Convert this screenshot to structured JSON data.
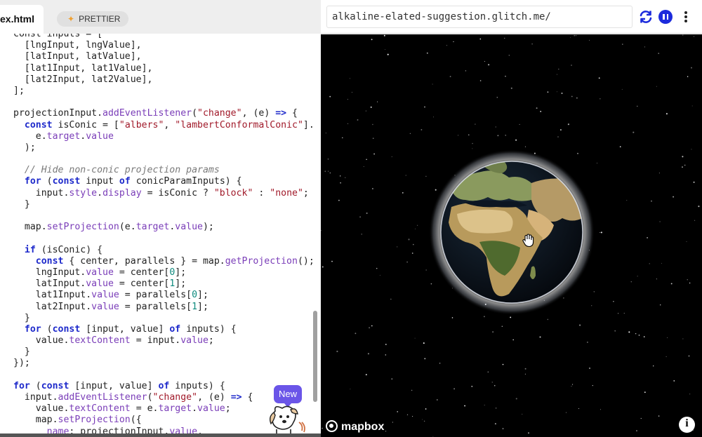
{
  "editor": {
    "file_tab": "ex.html",
    "prettier_label": "PRETTIER",
    "new_badge": "New"
  },
  "preview": {
    "url": "alkaline-elated-suggestion.glitch.me/",
    "mapbox_label": "mapbox",
    "info_label": "i"
  },
  "icons": {
    "refresh": "refresh-icon",
    "pause": "pause-icon",
    "menu": "kebab-menu-icon",
    "info": "info-icon",
    "cursor": "grab-hand-icon",
    "prettier": "sparkle-icon"
  },
  "colors": {
    "keyword": "#1e2acb",
    "string": "#a11a2a",
    "property": "#7a3db8",
    "number": "#0e8a7e",
    "comment": "#7a7a7a",
    "pause_button": "#1c2bdc",
    "new_badge": "#6a55e8"
  },
  "code": [
    [
      [
        "",
        "const inputs = ["
      ]
    ],
    [
      [
        "",
        "  [lngInput, lngValue],"
      ]
    ],
    [
      [
        "",
        "  [latInput, latValue],"
      ]
    ],
    [
      [
        "",
        "  [lat1Input, lat1Value],"
      ]
    ],
    [
      [
        "",
        "  [lat2Input, lat2Value],"
      ]
    ],
    [
      [
        "",
        "];"
      ]
    ],
    [
      [
        "",
        ""
      ]
    ],
    [
      [
        "",
        "projectionInput."
      ],
      [
        "p",
        "addEventListener"
      ],
      [
        "",
        "("
      ],
      [
        "s",
        "\"change\""
      ],
      [
        "",
        ", (e) "
      ],
      [
        "k",
        "=>"
      ],
      [
        "",
        " {"
      ]
    ],
    [
      [
        "",
        "  "
      ],
      [
        "k",
        "const"
      ],
      [
        "",
        " isConic = ["
      ],
      [
        "s",
        "\"albers\""
      ],
      [
        "",
        ", "
      ],
      [
        "s",
        "\"lambertConformalConic\""
      ],
      [
        "",
        "]."
      ]
    ],
    [
      [
        "",
        "    e."
      ],
      [
        "p",
        "target"
      ],
      [
        "",
        "."
      ],
      [
        "p",
        "value"
      ]
    ],
    [
      [
        "",
        "  );"
      ]
    ],
    [
      [
        "",
        ""
      ]
    ],
    [
      [
        "c",
        "  // Hide non-conic projection params"
      ]
    ],
    [
      [
        "",
        "  "
      ],
      [
        "k",
        "for"
      ],
      [
        "",
        " ("
      ],
      [
        "k",
        "const"
      ],
      [
        "",
        " input "
      ],
      [
        "k",
        "of"
      ],
      [
        "",
        " conicParamInputs) {"
      ]
    ],
    [
      [
        "",
        "    input."
      ],
      [
        "p",
        "style"
      ],
      [
        "",
        "."
      ],
      [
        "p",
        "display"
      ],
      [
        "",
        " = isConic ? "
      ],
      [
        "s",
        "\"block\""
      ],
      [
        "",
        " : "
      ],
      [
        "s",
        "\"none\""
      ],
      [
        "",
        ";"
      ]
    ],
    [
      [
        "",
        "  }"
      ]
    ],
    [
      [
        "",
        ""
      ]
    ],
    [
      [
        "",
        "  map."
      ],
      [
        "p",
        "setProjection"
      ],
      [
        "",
        "(e."
      ],
      [
        "p",
        "target"
      ],
      [
        "",
        "."
      ],
      [
        "p",
        "value"
      ],
      [
        "",
        ");"
      ]
    ],
    [
      [
        "",
        ""
      ]
    ],
    [
      [
        "",
        "  "
      ],
      [
        "k",
        "if"
      ],
      [
        "",
        " (isConic) {"
      ]
    ],
    [
      [
        "",
        "    "
      ],
      [
        "k",
        "const"
      ],
      [
        "",
        " { center, parallels } = map."
      ],
      [
        "p",
        "getProjection"
      ],
      [
        "",
        "();"
      ]
    ],
    [
      [
        "",
        "    lngInput."
      ],
      [
        "p",
        "value"
      ],
      [
        "",
        " = center["
      ],
      [
        "n",
        "0"
      ],
      [
        "",
        "];"
      ]
    ],
    [
      [
        "",
        "    latInput."
      ],
      [
        "p",
        "value"
      ],
      [
        "",
        " = center["
      ],
      [
        "n",
        "1"
      ],
      [
        "",
        "];"
      ]
    ],
    [
      [
        "",
        "    lat1Input."
      ],
      [
        "p",
        "value"
      ],
      [
        "",
        " = parallels["
      ],
      [
        "n",
        "0"
      ],
      [
        "",
        "];"
      ]
    ],
    [
      [
        "",
        "    lat2Input."
      ],
      [
        "p",
        "value"
      ],
      [
        "",
        " = parallels["
      ],
      [
        "n",
        "1"
      ],
      [
        "",
        "];"
      ]
    ],
    [
      [
        "",
        "  }"
      ]
    ],
    [
      [
        "",
        "  "
      ],
      [
        "k",
        "for"
      ],
      [
        "",
        " ("
      ],
      [
        "k",
        "const"
      ],
      [
        "",
        " [input, value] "
      ],
      [
        "k",
        "of"
      ],
      [
        "",
        " inputs) {"
      ]
    ],
    [
      [
        "",
        "    value."
      ],
      [
        "p",
        "textContent"
      ],
      [
        "",
        " = input."
      ],
      [
        "p",
        "value"
      ],
      [
        "",
        ";"
      ]
    ],
    [
      [
        "",
        "  }"
      ]
    ],
    [
      [
        "",
        "});"
      ]
    ],
    [
      [
        "",
        ""
      ]
    ],
    [
      [
        "k",
        "for"
      ],
      [
        "",
        " ("
      ],
      [
        "k",
        "const"
      ],
      [
        "",
        " [input, value] "
      ],
      [
        "k",
        "of"
      ],
      [
        "",
        " inputs) {"
      ]
    ],
    [
      [
        "",
        "  input."
      ],
      [
        "p",
        "addEventListener"
      ],
      [
        "",
        "("
      ],
      [
        "s",
        "\"change\""
      ],
      [
        "",
        ", (e) "
      ],
      [
        "k",
        "=>"
      ],
      [
        "",
        " {"
      ]
    ],
    [
      [
        "",
        "    value."
      ],
      [
        "p",
        "textContent"
      ],
      [
        "",
        " = e."
      ],
      [
        "p",
        "target"
      ],
      [
        "",
        "."
      ],
      [
        "p",
        "value"
      ],
      [
        "",
        ";"
      ]
    ],
    [
      [
        "",
        "    map."
      ],
      [
        "p",
        "setProjection"
      ],
      [
        "",
        "({"
      ]
    ],
    [
      [
        "",
        "      "
      ],
      [
        "p",
        "name"
      ],
      [
        "",
        ": projectionInput."
      ],
      [
        "p",
        "value"
      ],
      [
        "",
        ","
      ]
    ]
  ]
}
